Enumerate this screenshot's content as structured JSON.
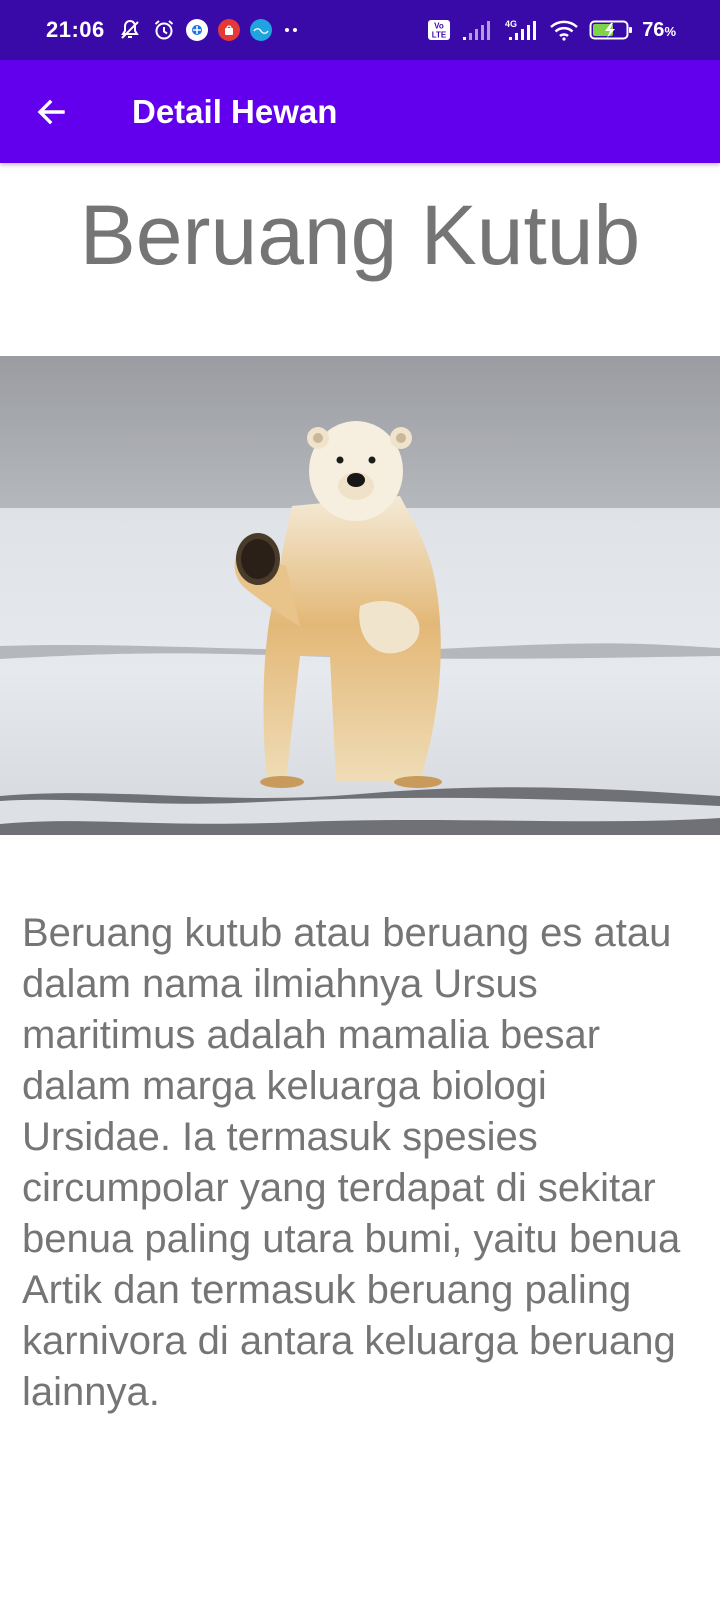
{
  "status_bar": {
    "time": "21:06",
    "battery_percent": "76",
    "battery_percent_sign": "%",
    "network_label": "4G",
    "volte_label": "Vo LTE",
    "icons": [
      "silent-bell-icon",
      "alarm-icon",
      "app-notification-icon",
      "app-notification-icon",
      "canva-icon",
      "more-dots-icon",
      "volte-icon",
      "signal-icon",
      "4g-signal-icon",
      "wifi-icon",
      "battery-charging-icon"
    ]
  },
  "app_bar": {
    "title": "Detail Hewan",
    "back_icon": "arrow-back-icon",
    "color": "#6200ee"
  },
  "animal": {
    "name": "Beruang Kutub",
    "image_alt": "polar-bear-photo",
    "description": "Beruang kutub atau beruang es atau dalam nama ilmiahnya Ursus maritimus adalah mamalia besar dalam marga keluarga biologi Ursidae. Ia termasuk spesies circumpolar yang terdapat di sekitar benua paling utara bumi, yaitu benua Artik dan termasuk beruang paling karnivora di antara keluarga beruang lainnya."
  },
  "colors": {
    "status_bar": "#3a0aa8",
    "text_gray": "#757575"
  }
}
